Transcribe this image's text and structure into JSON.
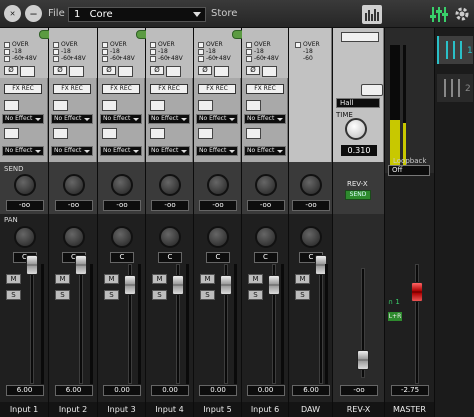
{
  "topbar": {
    "file_label": "File",
    "scene_number": "1",
    "scene_name": "Core",
    "store_label": "Store"
  },
  "common": {
    "over": "OVER",
    "m18": "-18",
    "m60": "-60",
    "p48": "+48V",
    "fxrec": "FX REC",
    "noeffect": "No Effect",
    "send_value": "-oo",
    "pan_value": "C",
    "mute": "M",
    "solo": "S",
    "phase": "Ø"
  },
  "channels": [
    {
      "name": "Input 1",
      "level": "6.00"
    },
    {
      "name": "Input 2",
      "level": "6.00"
    },
    {
      "name": "Input 3",
      "level": "0.00"
    },
    {
      "name": "Input 4",
      "level": "0.00"
    },
    {
      "name": "Input 5",
      "level": "0.00"
    },
    {
      "name": "Input 6",
      "level": "0.00"
    },
    {
      "name": "DAW",
      "level": "6.00"
    },
    {
      "name": "REV-X",
      "level": "-oo"
    },
    {
      "name": "MASTER",
      "level": "-2.75"
    }
  ],
  "sections": {
    "send": "SEND",
    "pan": "PAN"
  },
  "revx": {
    "type": "Hall",
    "time_label": "TIME",
    "time_value": "0.310",
    "send_title": "REV-X",
    "send_button": "SEND"
  },
  "right": {
    "loopback_label": "Loopback",
    "loopback_value": "Off",
    "tab1": "1",
    "tab2": "2",
    "master_indicator": "1",
    "master_ch": "L+R"
  },
  "colors": {
    "link": "#5b9b42",
    "accent": "#2ac0c8",
    "tab_active": "#2ac0c8"
  }
}
